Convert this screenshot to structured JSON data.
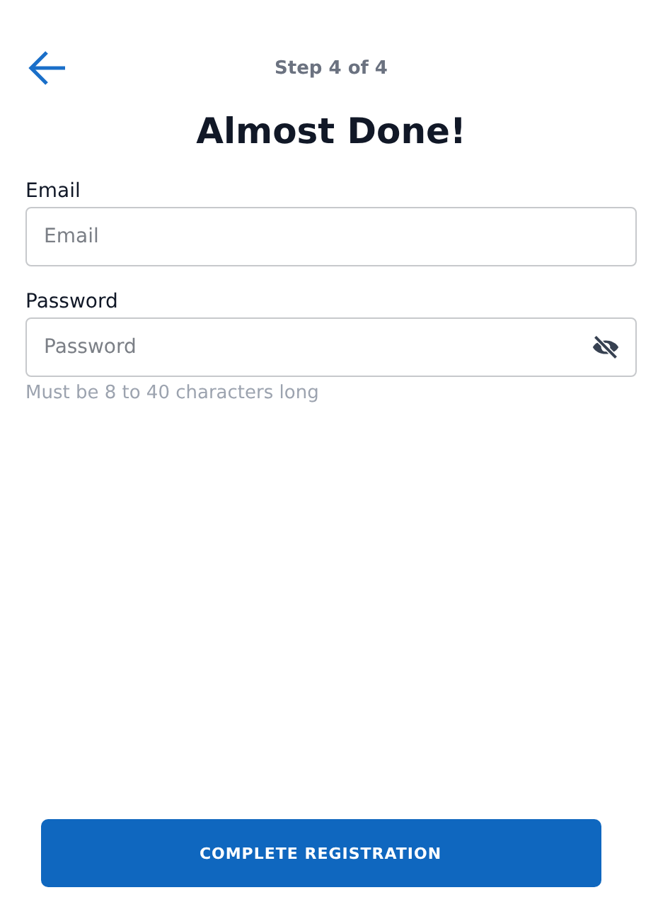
{
  "header": {
    "step": "Step 4 of 4"
  },
  "title": "Almost Done!",
  "fields": [
    {
      "label": "Email",
      "placeholder": "Email",
      "kind": "text"
    },
    {
      "label": "Password",
      "placeholder": "Password",
      "kind": "password",
      "password_visible": false,
      "hint": "Must be 8 to 40 characters long"
    }
  ],
  "submit": {
    "label": "COMPLETE REGISTRATION"
  }
}
